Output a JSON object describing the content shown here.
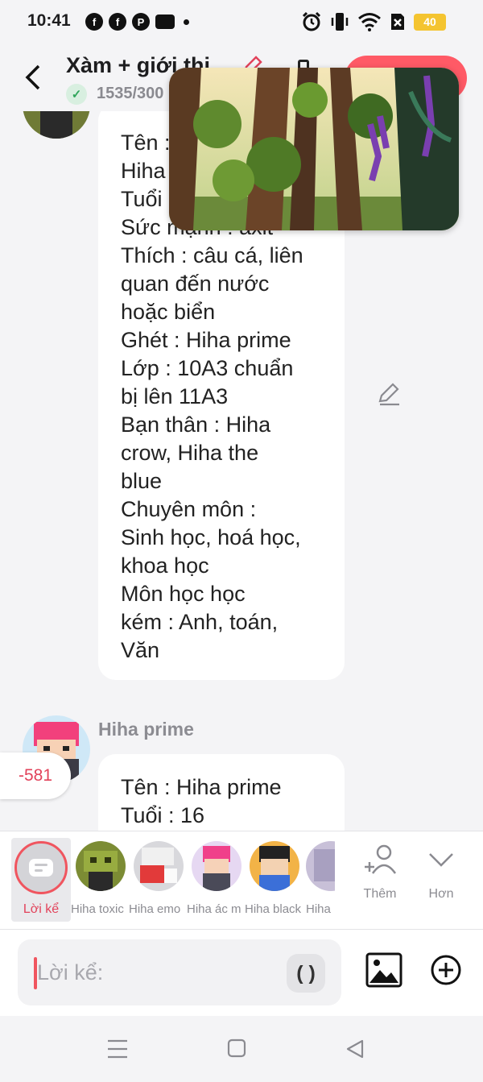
{
  "status_bar": {
    "time": "10:41",
    "battery_level": "40"
  },
  "header": {
    "title": "Xàm + giới thi",
    "char_count": "1535/300"
  },
  "messages": [
    {
      "lines": [
        "Tên :",
        "Hiha",
        "Tuổi",
        "Sức mạnh : axit",
        "Thích : câu cá, liên",
        "quan đến nước",
        "hoặc biển",
        "Ghét : Hiha prime",
        "Lớp : 10A3 chuẩn",
        "bị lên 11A3",
        "Bạn thân : Hiha",
        "crow, Hiha the",
        "blue",
        "Chuyên môn :",
        "Sinh học, hoá học,",
        "khoa học",
        "Môn học học",
        "kém : Anh, toán,",
        "Văn"
      ]
    },
    {
      "sender": "Hiha prime",
      "vote": "-581",
      "lines": [
        "Tên : Hiha prime",
        "Tuổi : 16"
      ]
    }
  ],
  "character_bar": {
    "narrator_label": "Lời kể",
    "characters": [
      {
        "label": "Hiha toxic"
      },
      {
        "label": "Hiha emo"
      },
      {
        "label": "Hiha ác m"
      },
      {
        "label": "Hiha black"
      },
      {
        "label": "Hiha"
      }
    ],
    "add_label": "Thêm",
    "more_label": "Hơn"
  },
  "input": {
    "placeholder": "Lời kể:",
    "paren_label": "( )"
  }
}
